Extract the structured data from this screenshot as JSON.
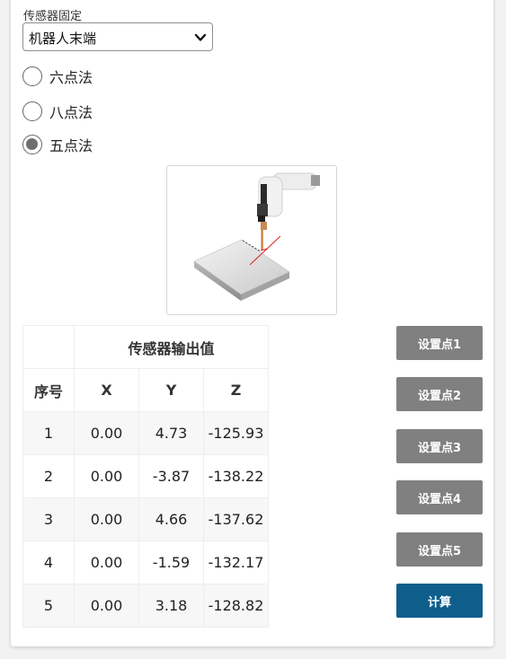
{
  "sensor_fixed": {
    "label": "传感器固定",
    "selected": "机器人末端"
  },
  "methods": [
    {
      "label": "六点法",
      "checked": false
    },
    {
      "label": "八点法",
      "checked": false
    },
    {
      "label": "五点法",
      "checked": true
    }
  ],
  "table": {
    "group_header": "传感器输出值",
    "headers": [
      "序号",
      "X",
      "Y",
      "Z"
    ],
    "rows": [
      [
        "1",
        "0.00",
        "4.73",
        "-125.93"
      ],
      [
        "2",
        "0.00",
        "-3.87",
        "-138.22"
      ],
      [
        "3",
        "0.00",
        "4.66",
        "-137.62"
      ],
      [
        "4",
        "0.00",
        "-1.59",
        "-132.17"
      ],
      [
        "5",
        "0.00",
        "3.18",
        "-128.82"
      ]
    ]
  },
  "buttons": {
    "set_point_1": "设置点1",
    "set_point_2": "设置点2",
    "set_point_3": "设置点3",
    "set_point_4": "设置点4",
    "set_point_5": "设置点5",
    "calculate": "计算"
  },
  "colors": {
    "primary": "#0e5e8c",
    "secondary": "#808080"
  },
  "icons": {
    "dropdown": "chevron-down-icon",
    "illustration": "robot-arm-probe-illustration"
  }
}
